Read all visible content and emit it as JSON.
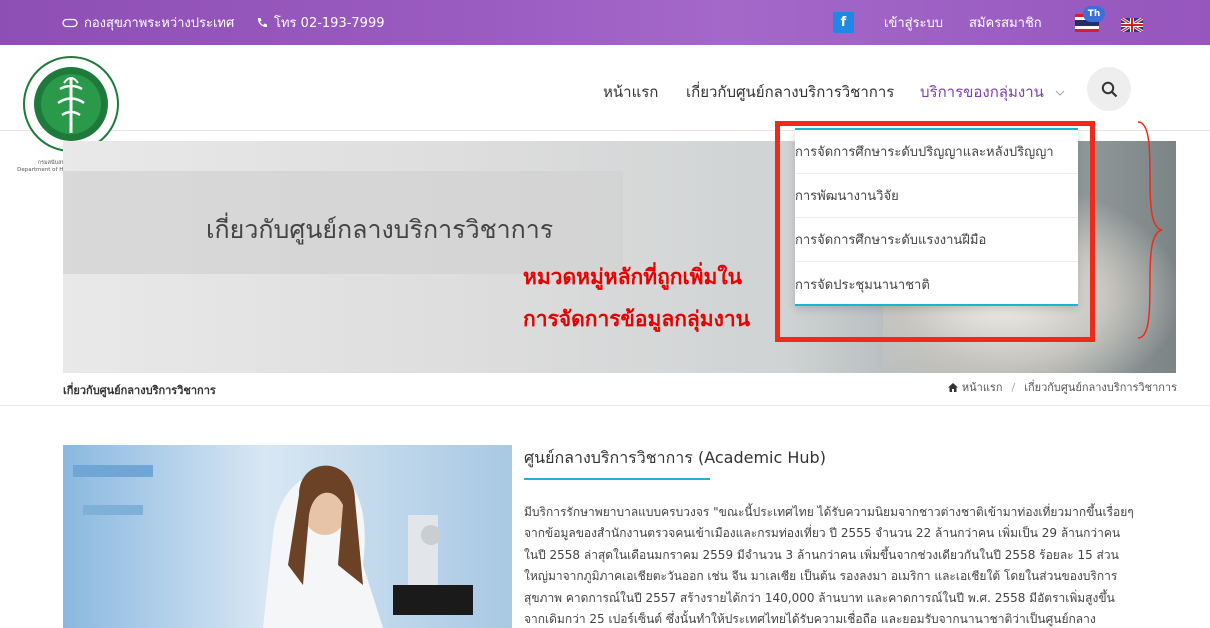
{
  "topbar": {
    "org_name": "กองสุขภาพระหว่างประเทศ",
    "phone": "โทร 02-193-7999",
    "facebook_label": "f",
    "login": "เข้าสู่ระบบ",
    "register": "สมัครสมาชิก",
    "lang_badge": "Th",
    "bg_color": "#9b5cc2"
  },
  "logo": {
    "caption_th": "กรมสนับสนุนบริการสุขภาพ",
    "caption_en": "Department of Health Service Support"
  },
  "nav": {
    "home": "หน้าแรก",
    "about": "เกี่ยวกับศูนย์กลางบริการวิชาการ",
    "services": "บริการของกลุ่มงาน",
    "services_color": "#7b3fb3"
  },
  "dropdown": {
    "items": [
      "การจัดการศึกษาระดับปริญญาและหลังปริญญา",
      "การพัฒนางานวิจัย",
      "การจัดการศึกษาระดับแรงงานฝีมือ",
      "การจัดประชุมนานาชาติ"
    ],
    "accent_color": "#1bb3d1"
  },
  "hero": {
    "title": "เกี่ยวกับศูนย์กลางบริการวิชาการ"
  },
  "annotation": {
    "line1": "หมวดหมู่หลักที่ถูกเพิ่มใน",
    "line2": "การจัดการข้อมูลกลุ่มงาน",
    "color": "#e60000"
  },
  "breadcrumb": {
    "page": "เกี่ยวกับศูนย์กลางบริการวิชาการ",
    "home": "หน้าแรก",
    "separator": "/",
    "current": "เกี่ยวกับศูนย์กลางบริการวิชาการ"
  },
  "content": {
    "title": "ศูนย์กลางบริการวิชาการ (Academic Hub)",
    "lines": [
      "มีบริการรักษาพยาบาลแบบครบวงจร \"ขณะนี้ประเทศไทย ได้รับความนิยมจากชาวต่างชาติเข้ามาท่องเที่ยวมากขึ้นเรื่อยๆ",
      "จากข้อมูลของสำนักงานตรวจคนเข้าเมืองและกรมท่องเที่ยว ปี 2555 จำนวน 22 ล้านกว่าคน เพิ่มเป็น 29 ล้านกว่าคน",
      "ในปี 2558 ล่าสุดในเดือนมกราคม 2559 มีจำนวน 3 ล้านกว่าคน เพิ่มขึ้นจากช่วงเดียวกันในปี 2558 ร้อยละ 15 ส่วน",
      "ใหญ่มาจากภูมิภาคเอเชียตะวันออก เช่น จีน มาเลเซีย เป็นต้น รองลงมา อเมริกา และเอเชียใต้ โดยในส่วนของบริการ",
      "สุขภาพ คาดการณ์ในปี 2557 สร้างรายได้กว่า 140,000 ล้านบาท และคาดการณ์ในปี พ.ศ. 2558 มีอัตราเพิ่มสูงขึ้น",
      "จากเดิมกว่า 25 เปอร์เซ็นต์ ซึ่งนั้นทำให้ประเทศไทยได้รับความเชื่อถือ และยอมรับจากนานาชาติว่าเป็นศูนย์กลาง"
    ]
  }
}
